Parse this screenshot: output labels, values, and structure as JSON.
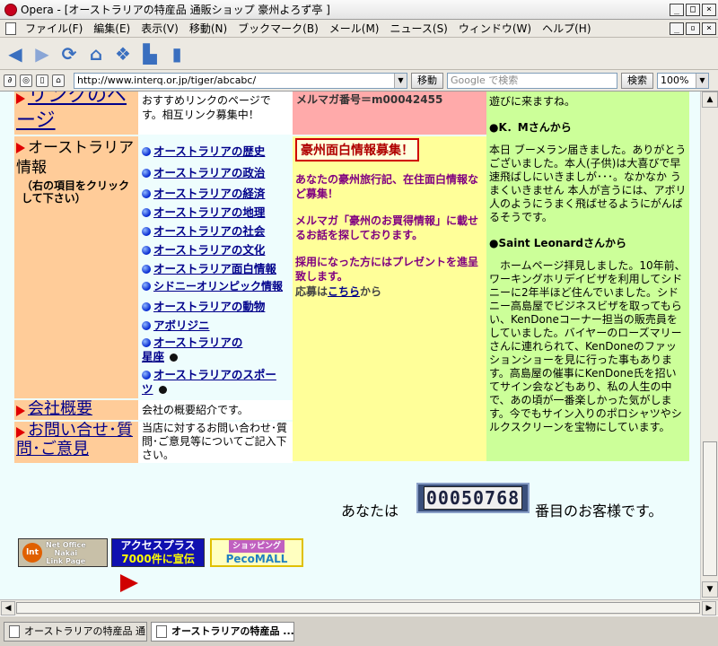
{
  "window": {
    "title": "Opera - [オーストラリアの特産品 通販ショップ 豪州よろず亭 ]",
    "min": "_",
    "max": "□",
    "close": "×",
    "restore": "▫",
    "mdi_close": "×"
  },
  "menu": [
    "ファイル(F)",
    "編集(E)",
    "表示(V)",
    "移動(N)",
    "ブックマーク(B)",
    "メール(M)",
    "ニュース(S)",
    "ウィンドウ(W)",
    "ヘルプ(H)"
  ],
  "toolbar_icons": [
    "back-icon",
    "forward-icon",
    "reload-icon",
    "home-icon",
    "hotlist-icon",
    "print-icon",
    "page-icon"
  ],
  "address": {
    "url": "http://www.interq.or.jp/tiger/abcabc/",
    "go": "移動",
    "search_placeholder": "Google で検索",
    "search_btn": "検索",
    "zoom": "100%"
  },
  "nav": {
    "links_page": "リンクのページ",
    "aus_info": "オーストラリア情報",
    "aus_info_note": "（右の項目をクリックして下さい）",
    "company": "会社概要",
    "contact": "お問い合せ･質問･ご意見"
  },
  "desc": {
    "links": "おすすめリンクのページです。相互リンク募集中！",
    "company": "会社の概要紹介です。",
    "contact": "当店に対するお問い合わせ･質問･ご意見等についてご記入下さい。"
  },
  "aus_links": [
    "オーストラリアの歴史",
    "オーストラリアの政治",
    "オーストラリアの経済",
    "オーストラリアの地理",
    "オーストラリアの社会",
    "オーストラリアの文化",
    "オーストラリア面白情報",
    "シドニーオリンピック情報",
    "オーストラリアの動物",
    "アボリジニ",
    "オーストラリアの星座",
    "オーストラリアのスポーツ"
  ],
  "mailmag": "メルマガ番号＝m00042455",
  "recruit": {
    "title": "豪州面白情報募集！",
    "p1": "あなたの豪州旅行記、在住面白情報など募集！",
    "p2": "メルマガ「豪州のお買得情報」に載せるお話を探しております。",
    "p3": "採用になった方にはプレゼントを進呈致します。",
    "apply_pre": "応募は",
    "apply_link": "こちら",
    "apply_post": "から"
  },
  "testimonials": {
    "top": "遊びに来ますね。",
    "name1": "●K．Mさんから",
    "text1": "本日 ブーメラン届きました。ありがとうございました。本人(子供)は大喜びで早速飛ばしにいきましが･･･。なかなか うまくいきません 本人が言うには、アボリ人のようにうまく飛ばせるようにがんばるそうです。",
    "name2": "●Saint Leonardさんから",
    "text2": "　ホームページ拝見しました。10年前、ワーキングホリデイビザを利用してシドニーに2年半ほど住んでいました。シドニー高島屋でビジネスビザを取ってもらい、KenDoneコーナー担当の販売員をしていました。バイヤーのローズマリーさんに連れられて、KenDoneのファッションショーを見に行った事もあります。高島屋の催事にKenDone氏を招いてサイン会などもあり、私の人生の中で、あの頃が一番楽しかった気がします。今でもサイン入りのポロシャツやシルクスクリーンを宝物にしています。"
  },
  "counter": {
    "prefix": "あなたは",
    "value": "00050768",
    "suffix": "番目のお客様です。"
  },
  "banners": {
    "b1_l1": "Net Office",
    "b1_l2": "Nakai",
    "b1_l3": "Link Page",
    "b1_logo": "lnt",
    "b2_l1": "アクセスプラス",
    "b2_l2": "7000件に宣伝",
    "b3_l1": "ショッピング",
    "b3_l2": "PecoMALL"
  },
  "tabs": [
    "オーストラリアの特産品 通...",
    "オーストラリアの特産品 ..."
  ],
  "colors": {
    "nav_bg": "#ffcc99",
    "recruit_bg": "#ffff99",
    "testimonial_bg": "#ccff99",
    "mailmag_bg": "#ffaaaa",
    "page_bg": "#eefdfd"
  }
}
